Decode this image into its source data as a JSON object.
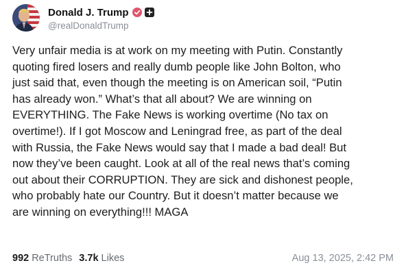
{
  "author": {
    "display_name": "Donald J. Trump",
    "handle": "@realDonaldTrump",
    "avatar_icon": "user-avatar",
    "verified_icon": "verified-badge-icon",
    "verified_color": "#e0566d",
    "extra_badge_icon": "plus-badge-icon"
  },
  "post": {
    "lines": [
      "Very unfair media is at work on my meeting with Putin. Constantly",
      "quoting fired losers and really dumb people like John Bolton, who",
      "just said that, even though the meeting is on American soil, “Putin",
      "has already won.” What’s that all about? We are winning on",
      "EVERYTHING. The Fake News is working overtime (No tax on",
      "overtime!). If I got Moscow and Leningrad free, as part of the deal",
      "with Russia, the Fake News would say that I made a bad deal! But",
      "now they’ve been caught. Look at all of the real news that’s coming",
      "out about their CORRUPTION. They are sick and dishonest people,",
      "who probably hate our Country. But it doesn’t matter because we",
      "are winning on everything!!! MAGA"
    ]
  },
  "stats": {
    "retruths_count": "992",
    "retruths_label": "ReTruths",
    "likes_count": "3.7k",
    "likes_label": "Likes"
  },
  "timestamp": "Aug 13, 2025, 2:42 PM"
}
